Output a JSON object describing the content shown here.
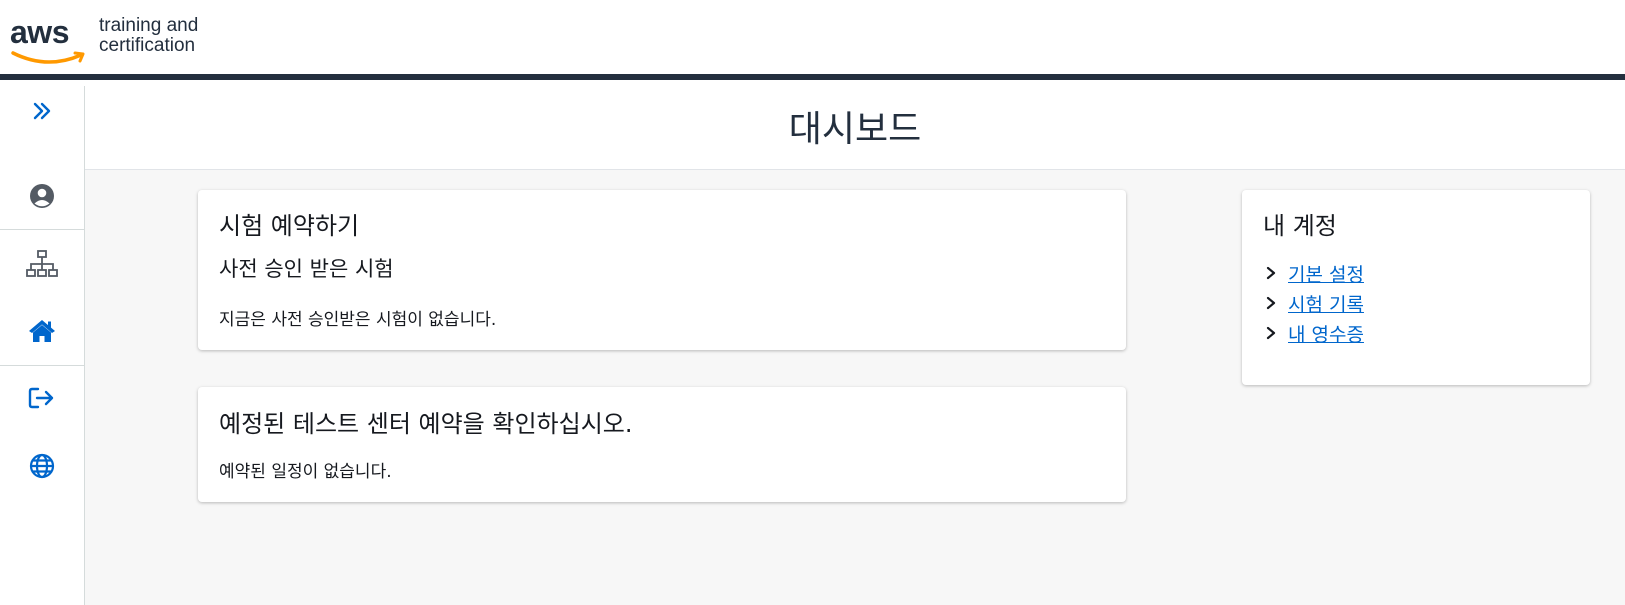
{
  "brand": {
    "logo_text": "aws",
    "tagline_line1": "training and",
    "tagline_line2": "certification",
    "accent_color": "#ff9900",
    "navy_color": "#232f3e",
    "link_color": "#0066cc"
  },
  "sidebar": {
    "items": [
      {
        "icon": "chevron-double-right-icon"
      },
      {
        "icon": "user-circle-icon"
      },
      {
        "icon": "sitemap-icon"
      },
      {
        "icon": "home-icon"
      },
      {
        "icon": "sign-out-icon"
      },
      {
        "icon": "globe-icon"
      }
    ]
  },
  "page": {
    "title": "대시보드"
  },
  "exam_card": {
    "title": "시험 예약하기",
    "subtitle": "사전 승인 받은 시험",
    "message": "지금은 사전 승인받은 시험이 없습니다."
  },
  "appointments_card": {
    "title": "예정된 테스트 센터 예약을 확인하십시오.",
    "message": "예약된 일정이 없습니다."
  },
  "account_card": {
    "title": "내 계정",
    "links": [
      {
        "label": "기본 설정"
      },
      {
        "label": "시험 기록"
      },
      {
        "label": "내 영수증"
      }
    ]
  }
}
